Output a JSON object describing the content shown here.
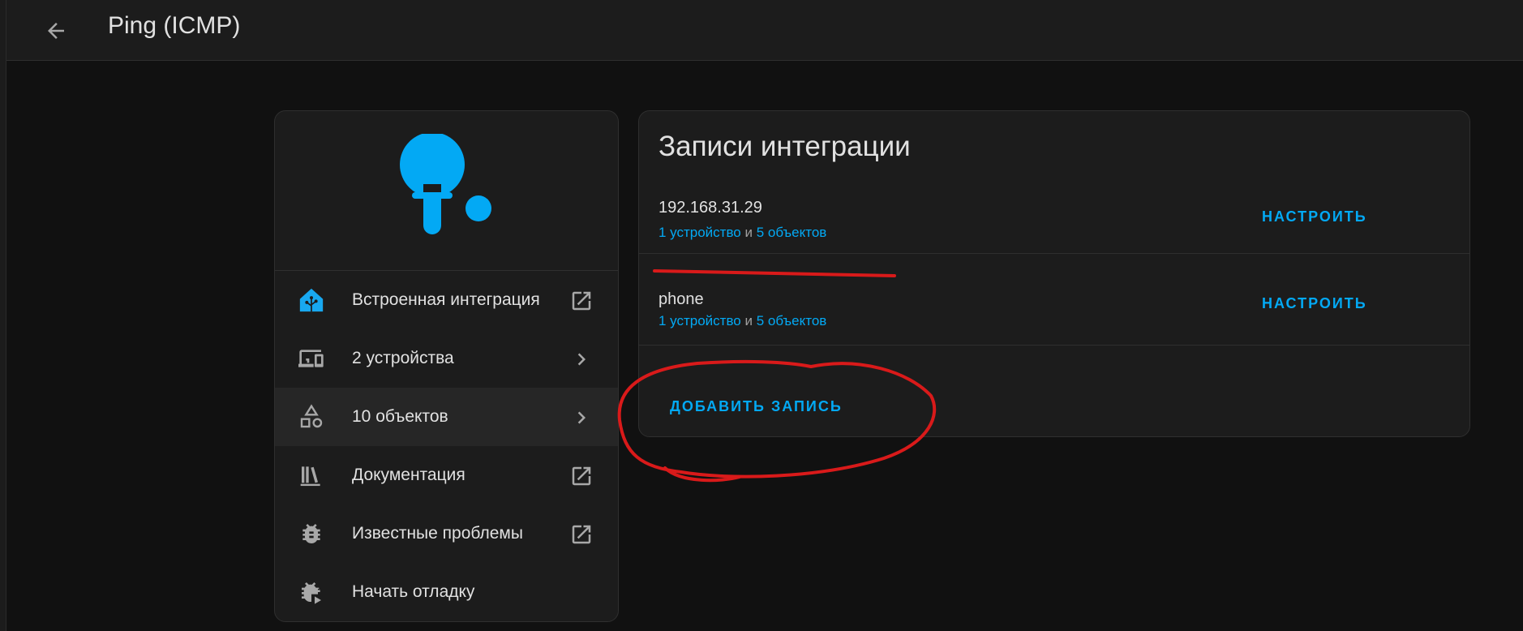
{
  "header": {
    "title": "Ping (ICMP)"
  },
  "colors": {
    "accent": "#03a9f4",
    "annotation": "#d91a1a",
    "background": "#111111",
    "card": "#1c1c1c"
  },
  "info_card": {
    "logo_icon": "ping-pong-paddle-icon",
    "items": [
      {
        "label": "Встроенная интеграция",
        "icon": "home-assistant-icon",
        "trail": "open-in-new-icon"
      },
      {
        "label": "2 устройства",
        "icon": "devices-icon",
        "trail": "chevron-right-icon"
      },
      {
        "label": "10 объектов",
        "icon": "shapes-icon",
        "trail": "chevron-right-icon"
      },
      {
        "label": "Документация",
        "icon": "bookshelf-icon",
        "trail": "open-in-new-icon"
      },
      {
        "label": "Известные проблемы",
        "icon": "bug-icon",
        "trail": "open-in-new-icon"
      },
      {
        "label": "Начать отладку",
        "icon": "bug-play-icon",
        "trail": ""
      }
    ]
  },
  "entries_card": {
    "title": "Записи интеграции",
    "entries": [
      {
        "name": "192.168.31.29",
        "devices_link": "1 устройство",
        "conjunction": "и",
        "entities_link": "5 объектов",
        "configure_label": "НАСТРОИТЬ"
      },
      {
        "name": "phone",
        "devices_link": "1 устройство",
        "conjunction": "и",
        "entities_link": "5 объектов",
        "configure_label": "НАСТРОИТЬ"
      }
    ],
    "add_entry_label": "ДОБАВИТЬ ЗАПИСЬ"
  }
}
